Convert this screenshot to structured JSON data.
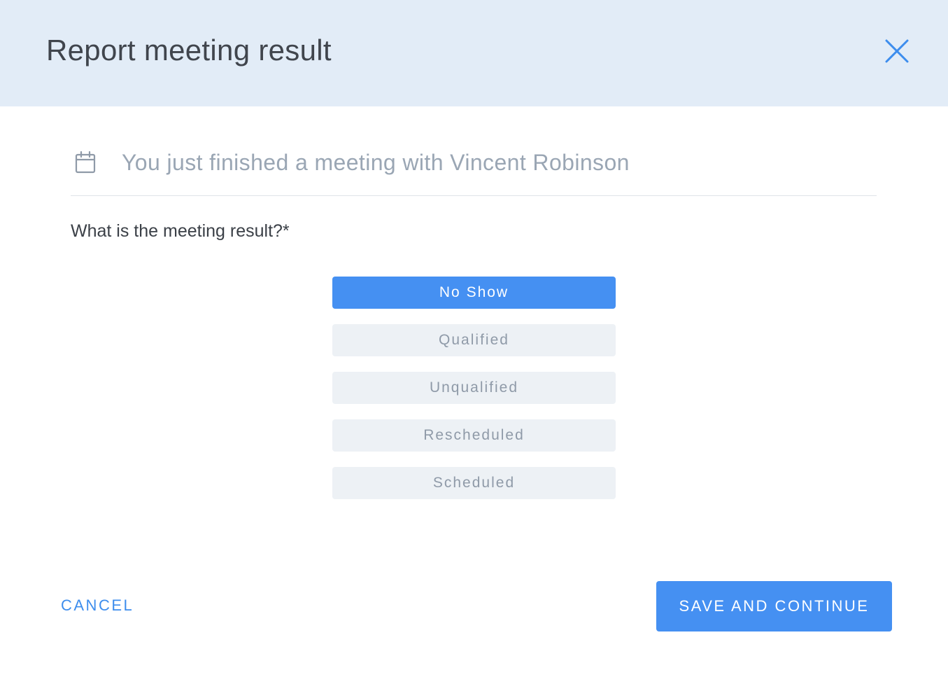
{
  "colors": {
    "accent": "#4590f2",
    "header_bg": "#e2ecf7",
    "option_bg": "#edf1f5",
    "option_text": "#8f9aa8",
    "title_text": "#40454d",
    "muted_text": "#9aa6b4"
  },
  "header": {
    "title": "Report meeting result",
    "close_icon": "close-icon"
  },
  "info": {
    "icon": "calendar-icon",
    "text": "You just finished a meeting with Vincent Robinson"
  },
  "form": {
    "question": "What is the meeting result?*",
    "selected_option": "No Show",
    "options": [
      {
        "label": "No Show",
        "selected": true
      },
      {
        "label": "Qualified",
        "selected": false
      },
      {
        "label": "Unqualified",
        "selected": false
      },
      {
        "label": "Rescheduled",
        "selected": false
      },
      {
        "label": "Scheduled",
        "selected": false
      }
    ]
  },
  "footer": {
    "cancel_label": "CANCEL",
    "save_label": "SAVE AND CONTINUE"
  }
}
